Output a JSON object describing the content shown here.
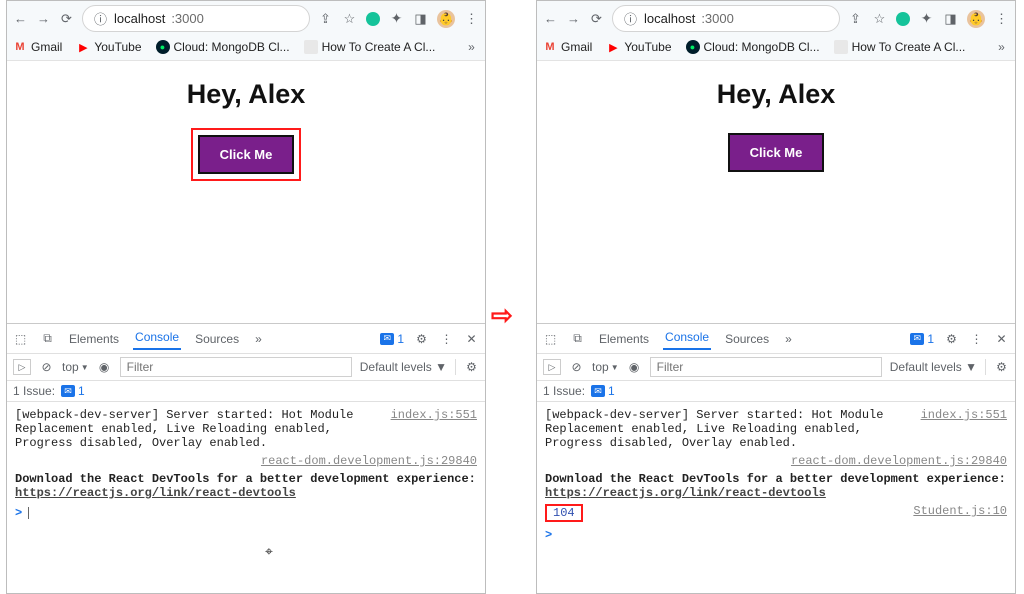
{
  "browser": {
    "url_host": "localhost",
    "url_port": ":3000",
    "bookmarks": {
      "gmail": "Gmail",
      "youtube": "YouTube",
      "mongo": "Cloud: MongoDB Cl...",
      "howto": "How To Create A Cl...",
      "more": "»"
    }
  },
  "page": {
    "heading": "Hey, Alex",
    "button_label": "Click Me"
  },
  "devtools": {
    "tabs": {
      "elements": "Elements",
      "console": "Console",
      "sources": "Sources",
      "more": "»"
    },
    "err_badge": "1",
    "filter": {
      "top": "top",
      "placeholder": "Filter",
      "levels": "Default levels ▼"
    },
    "issues": {
      "label": "1 Issue:",
      "count": "1"
    },
    "logs": {
      "webpack": "[webpack-dev-server] Server started: Hot Module Replacement enabled, Live Reloading enabled, Progress disabled, Overlay enabled.",
      "webpack_src": "index.js:551",
      "reactdev_src": "react-dom.development.js:29840",
      "react_line": "Download the React DevTools for a better development experience: ",
      "react_link": "https://reactjs.org/link/react-devtools",
      "extra_value": "104",
      "extra_src": "Student.js:10"
    }
  },
  "icons": {
    "back": "←",
    "forward": "→",
    "reload": "⟳",
    "info": "ⓘ",
    "share": "⇪",
    "star": "☆",
    "menu": "⋮",
    "puzzle": "✦",
    "panel": "◨",
    "inspect": "⬚",
    "device": "⧉",
    "gear": "⚙",
    "close": "✕",
    "play": "▷",
    "stop": "⊘",
    "eye": "◉",
    "dropdown": "▼",
    "msg": "✉",
    "prompt": ">"
  }
}
